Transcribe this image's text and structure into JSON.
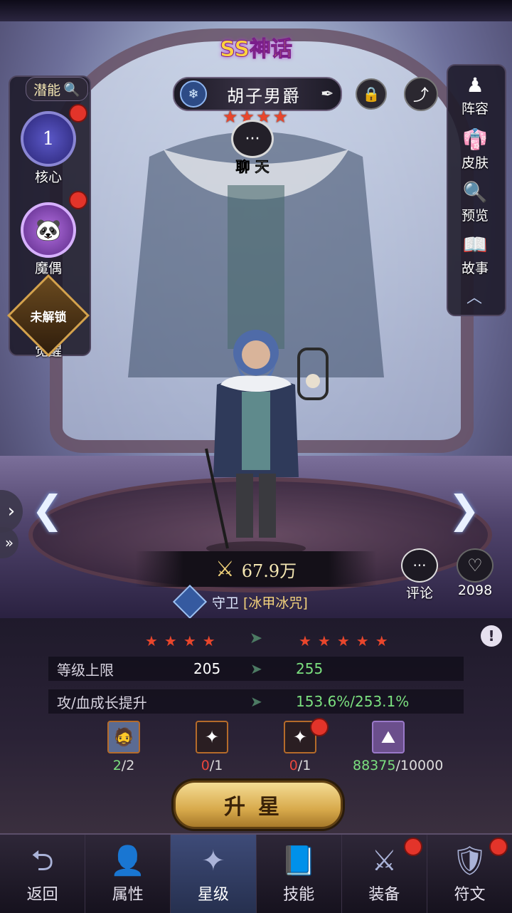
{
  "hero": {
    "rank": "SS神话",
    "name": "胡子男爵",
    "star_count": 4,
    "chat_label": "聊 天",
    "power": "67.9万",
    "role": "守卫",
    "skill_tag": "[冰甲冰咒]"
  },
  "left_panel": {
    "potential_tab": "潜能",
    "core": {
      "level": "1",
      "label": "核心"
    },
    "doll": {
      "label": "魔偶"
    },
    "awaken": {
      "status": "未解锁",
      "label": "觉醒"
    }
  },
  "right_panel": [
    {
      "label": "阵容",
      "icon": "lineup-icon"
    },
    {
      "label": "皮肤",
      "icon": "skin-icon"
    },
    {
      "label": "预览",
      "icon": "preview-icon"
    },
    {
      "label": "故事",
      "icon": "story-icon"
    }
  ],
  "social": {
    "comment_label": "评论",
    "likes": "2098"
  },
  "upgrade": {
    "current_stars": 4,
    "next_stars": 5,
    "rows": [
      {
        "label": "等级上限",
        "old": "205",
        "new": "255"
      },
      {
        "label": "攻/血成长提升",
        "old": "",
        "new": "153.6%/253.1%"
      }
    ],
    "materials": [
      {
        "icon": "hero-copy-icon",
        "have": "2",
        "need": "/2",
        "ok": true
      },
      {
        "icon": "ice-fodder-icon",
        "have": "0",
        "need": "/1",
        "ok": false
      },
      {
        "icon": "fodder-icon",
        "have": "0",
        "need": "/1",
        "ok": false
      },
      {
        "icon": "gold-ore-icon",
        "have": "88375",
        "need": "/10000",
        "ok": true
      }
    ],
    "button_label": "升星"
  },
  "nav": [
    {
      "label": "返回",
      "icon": "back-icon"
    },
    {
      "label": "属性",
      "icon": "attribute-icon"
    },
    {
      "label": "星级",
      "icon": "star-level-icon",
      "active": true
    },
    {
      "label": "技能",
      "icon": "skill-icon"
    },
    {
      "label": "装备",
      "icon": "equipment-icon",
      "badge": true
    },
    {
      "label": "符文",
      "icon": "rune-icon",
      "badge": true
    }
  ],
  "colors": {
    "accent_gold": "#d8aa4c",
    "star_red": "#e8462c",
    "increase_green": "#7be07f",
    "deficit_red": "#e8463c"
  }
}
